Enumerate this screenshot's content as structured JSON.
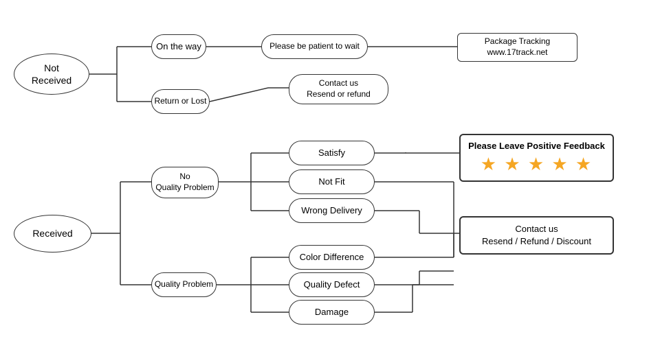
{
  "nodes": {
    "not_received": {
      "label": "Not\nReceived"
    },
    "on_the_way": {
      "label": "On the way"
    },
    "patient": {
      "label": "Please be patient to wait"
    },
    "tracking": {
      "label": "Package Tracking\nwww.17track.net"
    },
    "return_lost": {
      "label": "Return or Lost"
    },
    "contact_resend_refund": {
      "label": "Contact us\nResend or refund"
    },
    "received": {
      "label": "Received"
    },
    "no_quality": {
      "label": "No\nQuality Problem"
    },
    "quality_problem": {
      "label": "Quality Problem"
    },
    "satisfy": {
      "label": "Satisfy"
    },
    "not_fit": {
      "label": "Not Fit"
    },
    "wrong_delivery": {
      "label": "Wrong Delivery"
    },
    "color_diff": {
      "label": "Color Difference"
    },
    "quality_defect": {
      "label": "Quality Defect"
    },
    "damage": {
      "label": "Damage"
    },
    "feedback": {
      "label": "Please Leave Positive Feedback"
    },
    "stars": {
      "label": "★ ★ ★ ★ ★"
    },
    "contact_resend_refund_discount": {
      "label": "Contact us\nResend / Refund / Discount"
    }
  }
}
